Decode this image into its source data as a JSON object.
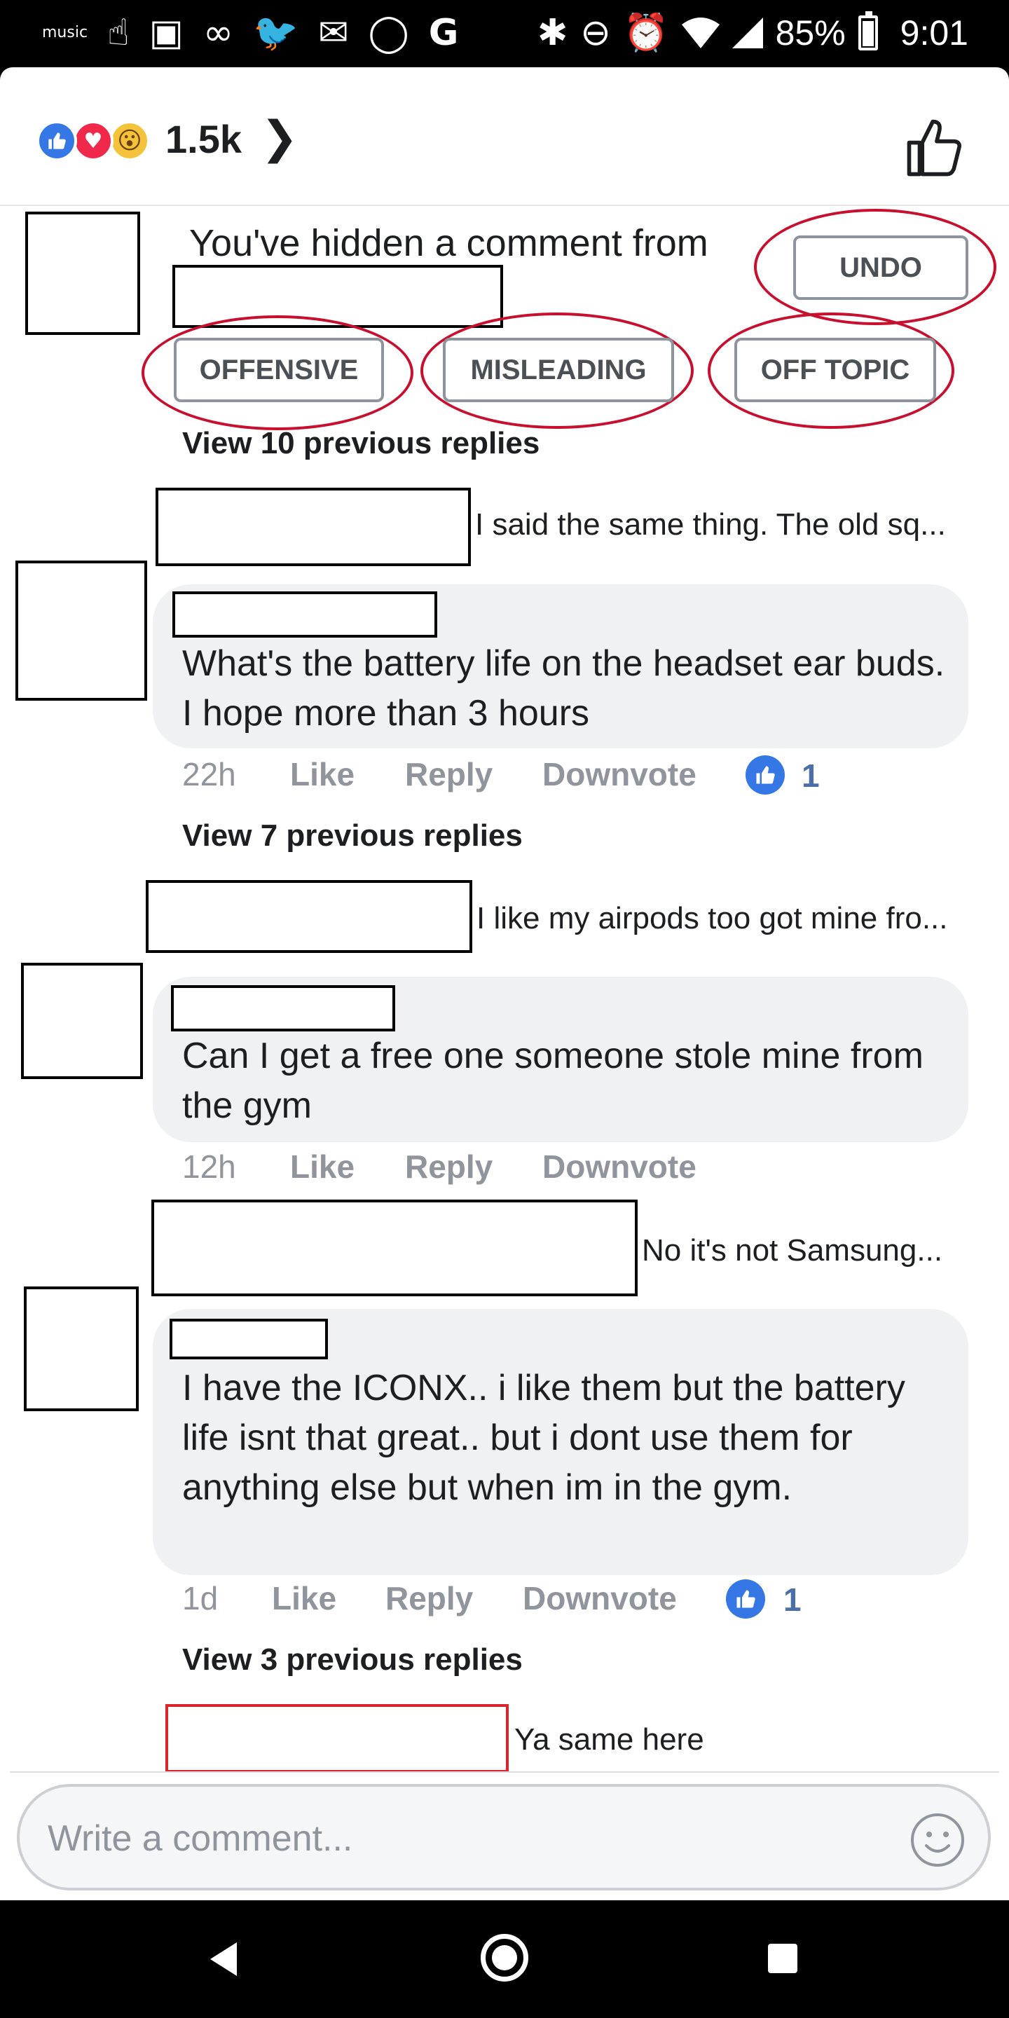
{
  "status_bar": {
    "app_label": "music",
    "battery_pct": "85%",
    "time": "9:01",
    "icons": [
      "amazon-music-icon",
      "touch-hand-icon",
      "outlook-icon",
      "voicemail-icon",
      "twitter-icon",
      "gmail-icon",
      "whatsapp-icon",
      "google-icon",
      "bluetooth-icon",
      "do-not-disturb-icon",
      "alarm-icon",
      "wifi-icon",
      "signal-icon",
      "battery-icon"
    ]
  },
  "reactions": {
    "count": "1.5k",
    "types": [
      "like",
      "love",
      "wow"
    ]
  },
  "hidden_comment": {
    "text": "You've hidden a comment from",
    "undo_label": "UNDO",
    "reasons": [
      "OFFENSIVE",
      "MISLEADING",
      "OFF TOPIC"
    ]
  },
  "threads": [
    {
      "view_replies": "View 10 previous replies",
      "reply_preview": "I said the same thing. The old sq...",
      "comment": "What's the battery life on the headset ear buds. I hope more than 3 hours",
      "time": "22h",
      "like_count": "1"
    },
    {
      "view_replies": "View 7 previous replies",
      "reply_preview": "I like my airpods too got mine fro...",
      "comment": "Can I get a free one someone stole mine from the gym",
      "time": "12h"
    },
    {
      "reply_preview": "No it's not Samsung...",
      "comment": "I have the ICONX.. i like them but the battery life isnt that great.. but i dont use them for anything else but when im in the gym.",
      "time": "1d",
      "like_count": "1"
    },
    {
      "view_replies": "View 3 previous replies",
      "reply_preview": "Ya same here"
    }
  ],
  "actions": {
    "like": "Like",
    "reply": "Reply",
    "downvote": "Downvote"
  },
  "composer": {
    "placeholder": "Write a comment..."
  },
  "colors": {
    "facebook_blue": "#3578e5",
    "love_red": "#f0284a",
    "highlight_red": "#c8102e",
    "bubble_gray": "#f0f1f3"
  }
}
